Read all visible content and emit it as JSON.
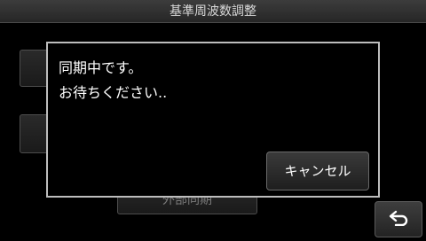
{
  "header": {
    "title": "基準周波数調整"
  },
  "background": {
    "bottom_button_label": "外部同期"
  },
  "dialog": {
    "line1": "同期中です。",
    "line2": "お待ちください..",
    "cancel_label": "キャンセル"
  },
  "icons": {
    "back": "return-arrow-icon"
  }
}
